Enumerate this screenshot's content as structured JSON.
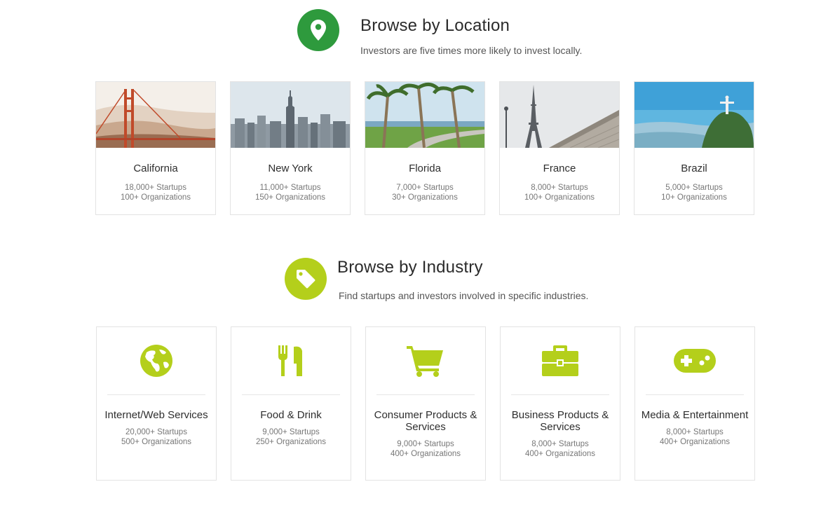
{
  "location": {
    "title": "Browse by Location",
    "subtitle": "Investors are five times more likely to invest locally.",
    "icon": "map-pin-icon",
    "accent": "#2e9a3d",
    "cards": [
      {
        "name": "California",
        "startups": "18,000+ Startups",
        "orgs": "100+ Organizations",
        "photo": "golden-gate-bridge"
      },
      {
        "name": "New York",
        "startups": "11,000+ Startups",
        "orgs": "150+ Organizations",
        "photo": "manhattan-skyline"
      },
      {
        "name": "Florida",
        "startups": "7,000+ Startups",
        "orgs": "30+ Organizations",
        "photo": "palm-tree-path"
      },
      {
        "name": "France",
        "startups": "8,000+ Startups",
        "orgs": "100+ Organizations",
        "photo": "eiffel-tower"
      },
      {
        "name": "Brazil",
        "startups": "5,000+ Startups",
        "orgs": "10+ Organizations",
        "photo": "christ-the-redeemer"
      }
    ]
  },
  "industry": {
    "title": "Browse by Industry",
    "subtitle": "Find startups and investors involved in specific industries.",
    "icon": "tag-icon",
    "accent": "#b4cf1b",
    "cards": [
      {
        "name": "Internet/Web Services",
        "startups": "20,000+ Startups",
        "orgs": "500+ Organizations",
        "icon": "globe-icon"
      },
      {
        "name": "Food & Drink",
        "startups": "9,000+ Startups",
        "orgs": "250+ Organizations",
        "icon": "fork-knife-icon"
      },
      {
        "name": "Consumer Products & Services",
        "startups": "9,000+ Startups",
        "orgs": "400+ Organizations",
        "icon": "shopping-cart-icon"
      },
      {
        "name": "Business Products & Services",
        "startups": "8,000+ Startups",
        "orgs": "400+ Organizations",
        "icon": "briefcase-icon"
      },
      {
        "name": "Media & Entertainment",
        "startups": "8,000+ Startups",
        "orgs": "400+ Organizations",
        "icon": "gamepad-icon"
      }
    ]
  }
}
